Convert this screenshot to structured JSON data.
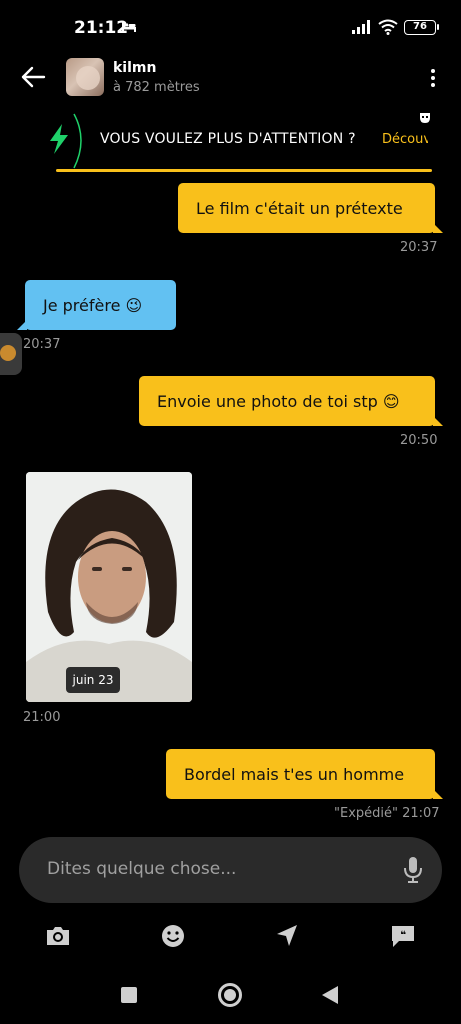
{
  "status_bar": {
    "time": "21:12",
    "battery": "76",
    "icons": [
      "bed-icon",
      "signal-icon",
      "wifi-icon",
      "battery-icon"
    ]
  },
  "header": {
    "name": "kilmn",
    "distance": "à 782 mètres",
    "icons": [
      "back-arrow-icon",
      "more-vertical-icon"
    ]
  },
  "promo": {
    "text": "VOUS VOULEZ PLUS D'ATTENTION ?",
    "cta": "Découvrir",
    "accent": "#f9c01b",
    "bolt_color": "#1fd16a"
  },
  "messages": [
    {
      "side": "sent",
      "text": "Le film c'était un prétexte",
      "time": "20:37"
    },
    {
      "side": "received",
      "text": "Je préfère 😉",
      "time": "20:37"
    },
    {
      "side": "sent",
      "text": "Envoie une photo de toi stp 😊",
      "time": "20:50"
    },
    {
      "side": "received",
      "type": "photo",
      "date_badge": "juin 23",
      "time": "21:00"
    },
    {
      "side": "sent",
      "text": "Bordel mais t'es un homme",
      "time": "\"Expédié\" 21:07"
    }
  ],
  "input": {
    "placeholder": "Dites quelque chose..."
  },
  "toolbar": [
    "camera-icon",
    "emoji-icon",
    "location-icon",
    "quick-reply-icon"
  ],
  "colors": {
    "sent_bubble": "#f9c01b",
    "received_bubble": "#62c1f2",
    "background": "#000000"
  }
}
